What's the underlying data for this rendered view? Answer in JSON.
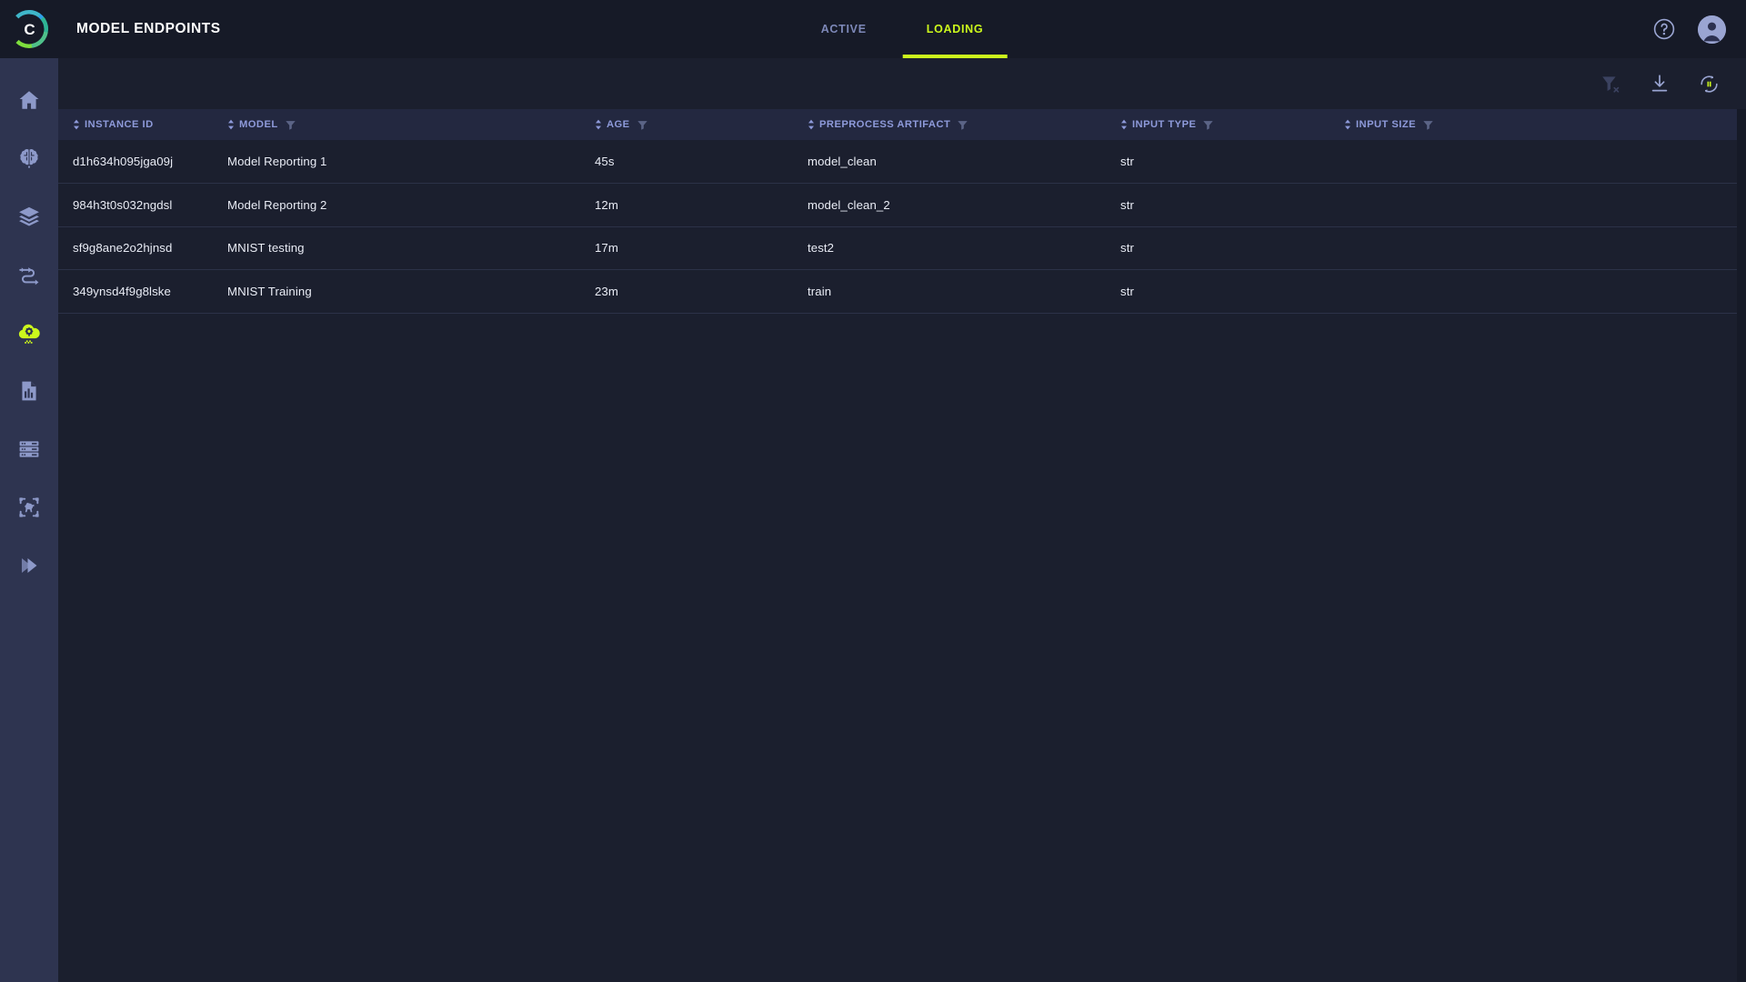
{
  "app": {
    "logo_letter": "C",
    "accent": "#ccf81c",
    "sidebar_bg": "#2e3450",
    "header_bg": "#161a27",
    "body_bg": "#1b1f2e",
    "header_row_bg": "#232840",
    "icon_color": "#8d99c9",
    "link_color": "#7d88b8"
  },
  "header": {
    "title": "MODEL ENDPOINTS",
    "tabs": [
      {
        "label": "ACTIVE",
        "active": false,
        "name": "tab-active"
      },
      {
        "label": "LOADING",
        "active": true,
        "name": "tab-loading"
      }
    ],
    "actions": [
      {
        "name": "help-icon",
        "label": "Help"
      },
      {
        "name": "avatar",
        "label": "Account"
      }
    ]
  },
  "toolbar": {
    "buttons": [
      {
        "name": "clear-filter-icon",
        "label": "Clear filters",
        "state": "disabled"
      },
      {
        "name": "download-icon",
        "label": "Download",
        "state": "enabled"
      },
      {
        "name": "refresh-pause-icon",
        "label": "Pause auto refresh",
        "state": "enabled"
      }
    ]
  },
  "sidebar": {
    "items": [
      {
        "name": "sidebar-item-home",
        "icon": "home-icon",
        "label": "Home",
        "active": false
      },
      {
        "name": "sidebar-item-models",
        "icon": "brain-icon",
        "label": "Models",
        "active": false
      },
      {
        "name": "sidebar-item-datasets",
        "icon": "layers-icon",
        "label": "Datasets",
        "active": false
      },
      {
        "name": "sidebar-item-pipelines",
        "icon": "workflow-icon",
        "label": "Pipelines",
        "active": false
      },
      {
        "name": "sidebar-item-model-endpoints",
        "icon": "cloud-gear-icon",
        "label": "Model Endpoints",
        "active": true
      },
      {
        "name": "sidebar-item-reports",
        "icon": "document-chart-icon",
        "label": "Reports",
        "active": false
      },
      {
        "name": "sidebar-item-infrastructure",
        "icon": "server-icon",
        "label": "Infrastructure",
        "active": false
      },
      {
        "name": "sidebar-item-annotations",
        "icon": "image-detection-icon",
        "label": "Annotations",
        "active": false
      },
      {
        "name": "sidebar-item-deploy",
        "icon": "double-chevron-icon",
        "label": "Deploy",
        "active": false
      }
    ]
  },
  "table": {
    "columns": [
      {
        "key": "instance_id",
        "label": "INSTANCE ID",
        "sortable": true,
        "filterable": false
      },
      {
        "key": "model",
        "label": "MODEL",
        "sortable": true,
        "filterable": true
      },
      {
        "key": "age",
        "label": "AGE",
        "sortable": true,
        "filterable": true
      },
      {
        "key": "preprocess_artifact",
        "label": "PREPROCESS ARTIFACT",
        "sortable": true,
        "filterable": true
      },
      {
        "key": "input_type",
        "label": "INPUT TYPE",
        "sortable": true,
        "filterable": true
      },
      {
        "key": "input_size",
        "label": "INPUT SIZE",
        "sortable": true,
        "filterable": true
      }
    ],
    "rows": [
      {
        "instance_id": "d1h634h095jga09j",
        "model": "Model Reporting 1",
        "age": "45s",
        "preprocess_artifact": "model_clean",
        "input_type": "str",
        "input_size": ""
      },
      {
        "instance_id": "984h3t0s032ngdsl",
        "model": "Model Reporting 2",
        "age": "12m",
        "preprocess_artifact": "model_clean_2",
        "input_type": "str",
        "input_size": ""
      },
      {
        "instance_id": "sf9g8ane2o2hjnsd",
        "model": "MNIST testing",
        "age": "17m",
        "preprocess_artifact": "test2",
        "input_type": "str",
        "input_size": ""
      },
      {
        "instance_id": "349ynsd4f9g8lske",
        "model": "MNIST Training",
        "age": "23m",
        "preprocess_artifact": "train",
        "input_type": "str",
        "input_size": ""
      }
    ]
  }
}
